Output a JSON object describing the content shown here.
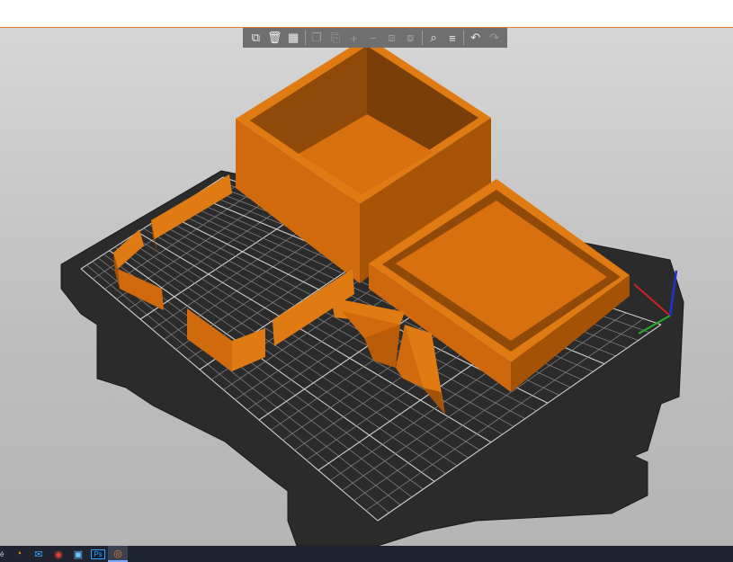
{
  "app": {
    "accent": "#d97a3a",
    "model_color": "#d96f0e",
    "bed_color": "#2a2a2a"
  },
  "toolbar": {
    "buttons": [
      {
        "name": "add-button",
        "icon": "add-object-icon",
        "enabled": true
      },
      {
        "name": "delete-button",
        "icon": "trash-icon",
        "enabled": true
      },
      {
        "name": "arrange-button",
        "icon": "arrange-icon",
        "enabled": true
      },
      {
        "name": "copy-button",
        "icon": "copy-icon",
        "enabled": false
      },
      {
        "name": "paste-button",
        "icon": "paste-icon",
        "enabled": false
      },
      {
        "name": "add-instance-button",
        "icon": "plus-icon",
        "enabled": false
      },
      {
        "name": "remove-instance-button",
        "icon": "minus-icon",
        "enabled": false
      },
      {
        "name": "split-objects-button",
        "icon": "split-objects-icon",
        "enabled": false
      },
      {
        "name": "split-parts-button",
        "icon": "split-parts-icon",
        "enabled": false
      },
      {
        "name": "search-button",
        "icon": "search-icon",
        "enabled": true
      },
      {
        "name": "layers-button",
        "icon": "layers-icon",
        "enabled": true
      },
      {
        "name": "undo-button",
        "icon": "undo-icon",
        "enabled": true
      },
      {
        "name": "redo-button",
        "icon": "redo-icon",
        "enabled": false
      }
    ]
  },
  "taskbar": {
    "label": "é",
    "apps": [
      {
        "name": "blender-app",
        "icon": "blender-icon",
        "active": false
      },
      {
        "name": "mail-app",
        "icon": "mail-icon",
        "active": false
      },
      {
        "name": "chrome-app",
        "icon": "chrome-icon",
        "active": false
      },
      {
        "name": "files-app",
        "icon": "files-icon",
        "active": false
      },
      {
        "name": "photoshop-app",
        "icon": "photoshop-icon",
        "label": "Ps",
        "active": false
      },
      {
        "name": "prusaslicer-app",
        "icon": "prusaslicer-icon",
        "active": true
      }
    ]
  }
}
